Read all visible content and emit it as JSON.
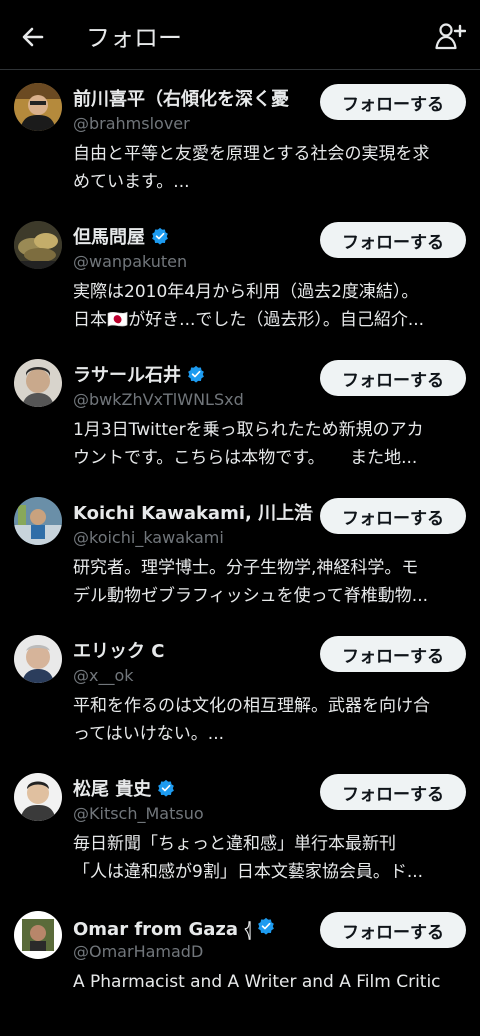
{
  "header": {
    "title": "フォロー",
    "back_icon": "arrow-left-icon",
    "add_icon": "add-user-icon"
  },
  "accent": "#1d9bf0",
  "users": [
    {
      "name": "前川喜平（右傾化を深く憂",
      "handle": "@brahmslover",
      "verified": false,
      "bio_lines": [
        "自由と平等と友愛を原理とする社会の実現を求",
        "めています。..."
      ],
      "follow_label": "フォローする"
    },
    {
      "name": "但馬問屋",
      "handle": "@wanpakuten",
      "verified": true,
      "bio_lines": [
        "実際は2010年4月から利用（過去2度凍結）。",
        "日本🇯🇵が好き...でした（過去形）。自己紹介..."
      ],
      "follow_label": "フォローする"
    },
    {
      "name": "ラサール石井",
      "handle": "@bwkZhVxTlWNLSxd",
      "verified": true,
      "bio_lines": [
        "1月3日Twitterを乗っ取られたため新規のアカ",
        "ウントです。こちらは本物です。　　また地..."
      ],
      "follow_label": "フォローする"
    },
    {
      "name": "Koichi Kawakami, 川上浩一",
      "handle": "@koichi_kawakami",
      "verified": false,
      "bio_lines": [
        "研究者。理学博士。分子生物学,神経科学。モ",
        "デル動物ゼブラフィッシュを使って脊椎動物..."
      ],
      "follow_label": "フォローする"
    },
    {
      "name": "エリック C",
      "handle": "@x__ok",
      "verified": false,
      "bio_lines": [
        "平和を作るのは文化の相互理解。武器を向け合",
        "ってはいけない。..."
      ],
      "follow_label": "フォローする"
    },
    {
      "name": "松尾 貴史",
      "handle": "@Kitsch_Matsuo",
      "verified": true,
      "bio_lines": [
        "毎日新聞「ちょっと違和感」単行本最新刊",
        "「人は違和感が9割」日本文藝家協会員。ド..."
      ],
      "follow_label": "フォローする"
    },
    {
      "name": "Omar from Gaza 𓂆",
      "handle": "@OmarHamadD",
      "verified": true,
      "bio_lines": [
        "A Pharmacist and A Writer and A Film Critic",
        ""
      ],
      "follow_label": "フォローする"
    }
  ]
}
